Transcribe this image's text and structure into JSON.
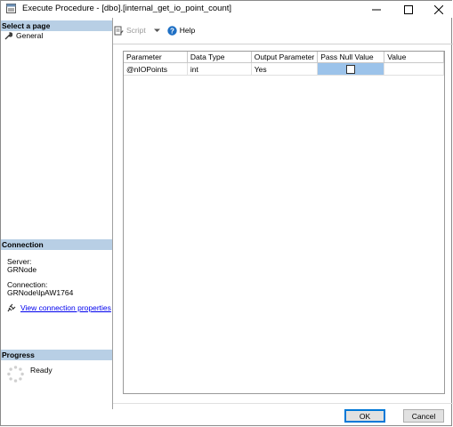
{
  "window": {
    "title": "Execute Procedure - [dbo].[internal_get_io_point_count]"
  },
  "left": {
    "select_page_header": "Select a page",
    "nav_items": [
      {
        "label": "General"
      }
    ],
    "connection_header": "Connection",
    "server_label": "Server:",
    "server_value": "GRNode",
    "connection_label": "Connection:",
    "connection_value": "GRNode\\lpAW1764",
    "view_connection_link": "View connection properties",
    "progress_header": "Progress",
    "progress_status": "Ready"
  },
  "toolbar": {
    "script_label": "Script",
    "help_label": "Help"
  },
  "grid": {
    "columns": [
      "Parameter",
      "Data Type",
      "Output Parameter",
      "Pass Null Value",
      "Value"
    ],
    "rows": [
      {
        "parameter": "@nIOPoints",
        "data_type": "int",
        "output_parameter": "Yes",
        "pass_null_value": false,
        "value": ""
      }
    ]
  },
  "buttons": {
    "ok": "OK",
    "cancel": "Cancel"
  },
  "colors": {
    "section_header": "#b8cfe5",
    "selected_cell": "#9cc3ea",
    "link": "#0000ee"
  },
  "icons": {
    "title": "dialog-app-icon",
    "general": "wrench-icon",
    "connection": "connection-plug-icon",
    "progress": "spinner-icon",
    "script": "script-icon",
    "help": "help-icon"
  }
}
